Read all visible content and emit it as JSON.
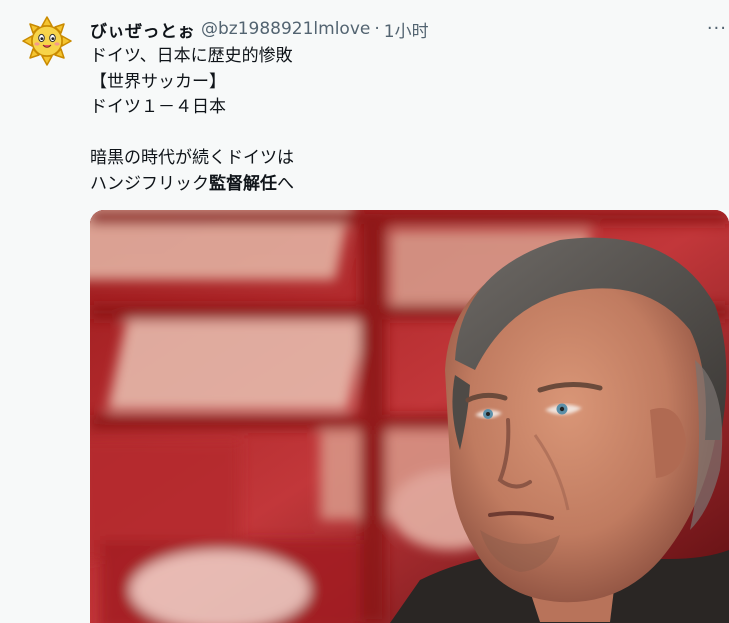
{
  "tweet": {
    "display_name": "びぃぜっとぉ",
    "handle": "@bz1988921lmlove",
    "separator": "·",
    "time": "1小时",
    "more_label": "···",
    "lines": [
      {
        "text": "ドイツ、日本に歴史的惨敗"
      },
      {
        "text": "【世界サッカー】"
      },
      {
        "text": "ドイツ１－４日本"
      },
      {
        "text": ""
      },
      {
        "text": "暗黒の時代が続くドイツは"
      },
      {
        "pre": "ハンジフリック",
        "bold": "監督解任",
        "post": "へ"
      }
    ],
    "avatar_icon": "sun-face-icon",
    "media_icon": "coach-portrait-photo"
  }
}
